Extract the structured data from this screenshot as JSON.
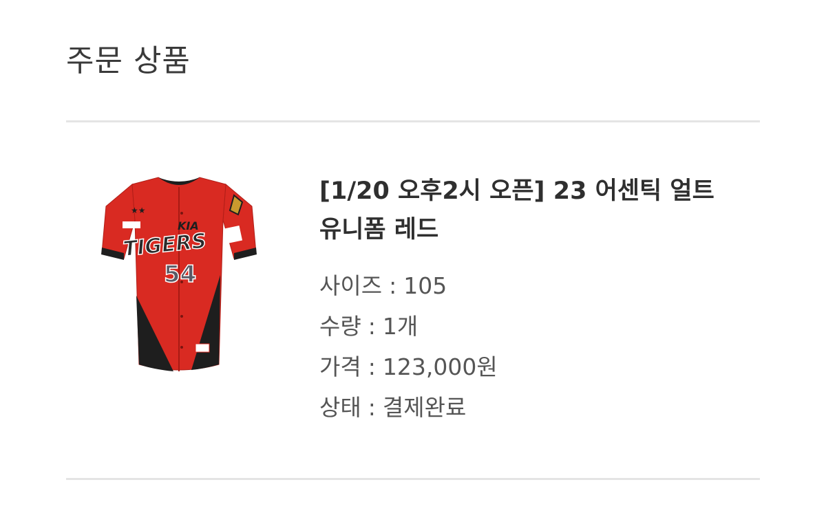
{
  "header": {
    "title": "주문 상품"
  },
  "product": {
    "name": "[1/20 오후2시 오픈] 23 어센틱 얼트 유니폼 레드",
    "jersey": {
      "wordmark": "TIGERS",
      "number": "54",
      "sponsor": "KIA"
    },
    "colors": {
      "jersey_red": "#d92a22",
      "panel_black": "#1e1e1e",
      "number_gray": "#5a5a66"
    }
  },
  "details": [
    {
      "label": "사이즈",
      "value": "105"
    },
    {
      "label": "수량",
      "value": "1개"
    },
    {
      "label": "가격",
      "value": "123,000원"
    },
    {
      "label": "상태",
      "value": "결제완료"
    }
  ],
  "separator": ":"
}
